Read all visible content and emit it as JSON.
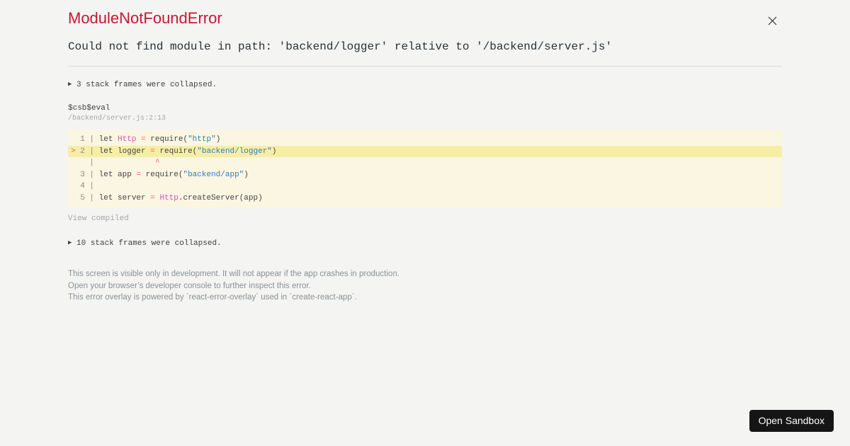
{
  "header": {
    "title": "ModuleNotFoundError"
  },
  "error": {
    "message": "Could not find module in path: 'backend/logger' relative to '/backend/server.js'"
  },
  "stack": {
    "marker": "▶",
    "collapsed_top": " 3 stack frames were collapsed.",
    "collapsed_bottom": " 10 stack frames were collapsed.",
    "frame": {
      "function": "$csb$eval",
      "location": "/backend/server.js:2:13"
    },
    "view_compiled": "View compiled"
  },
  "code": {
    "highlight_line": 2,
    "error_position": "2:13",
    "lines": [
      {
        "num": "1",
        "marker": "",
        "highlight": false,
        "tokens": [
          {
            "c": "plain",
            "t": "let "
          },
          {
            "c": "magenta",
            "t": "Http"
          },
          {
            "c": "plain",
            "t": " "
          },
          {
            "c": "red",
            "t": "="
          },
          {
            "c": "plain",
            "t": " require("
          },
          {
            "c": "blue",
            "t": "\"http\""
          },
          {
            "c": "plain",
            "t": ")"
          }
        ]
      },
      {
        "num": "2",
        "marker": ">",
        "highlight": true,
        "tokens": [
          {
            "c": "plain",
            "t": "let logger "
          },
          {
            "c": "red",
            "t": "="
          },
          {
            "c": "plain",
            "t": " require("
          },
          {
            "c": "blue",
            "t": "\"backend/logger\""
          },
          {
            "c": "plain",
            "t": ")"
          }
        ]
      },
      {
        "num": "",
        "marker": "",
        "highlight": false,
        "tokens": [
          {
            "c": "plain",
            "t": "            "
          },
          {
            "c": "red",
            "t": "^"
          }
        ]
      },
      {
        "num": "3",
        "marker": "",
        "highlight": false,
        "tokens": [
          {
            "c": "plain",
            "t": "let app "
          },
          {
            "c": "red",
            "t": "="
          },
          {
            "c": "plain",
            "t": " require("
          },
          {
            "c": "blue",
            "t": "\"backend/app\""
          },
          {
            "c": "plain",
            "t": ")"
          }
        ]
      },
      {
        "num": "4",
        "marker": "",
        "highlight": false,
        "tokens": []
      },
      {
        "num": "5",
        "marker": "",
        "highlight": false,
        "tokens": [
          {
            "c": "plain",
            "t": "let server "
          },
          {
            "c": "red",
            "t": "="
          },
          {
            "c": "plain",
            "t": " "
          },
          {
            "c": "magenta",
            "t": "Http"
          },
          {
            "c": "plain",
            "t": ".createServer(app)"
          }
        ]
      }
    ]
  },
  "footer": {
    "lines": [
      "This screen is visible only in development. It will not appear if the app crashes in production.",
      "Open your browser’s developer console to further inspect this error.",
      "This error overlay is powered by `react-error-overlay` used in `create-react-app`."
    ]
  },
  "sandbox_button": {
    "label": "Open Sandbox"
  },
  "colors": {
    "accent-red": "#cb1530",
    "code-bg": "#faf6e2",
    "code-highlight": "#f6eea4",
    "tok-magenta": "#cd56b7",
    "tok-red": "#ec5f67",
    "tok-blue": "#2f7cc3",
    "btn-bg": "#151515",
    "page-bg": "#f4f4f3"
  }
}
